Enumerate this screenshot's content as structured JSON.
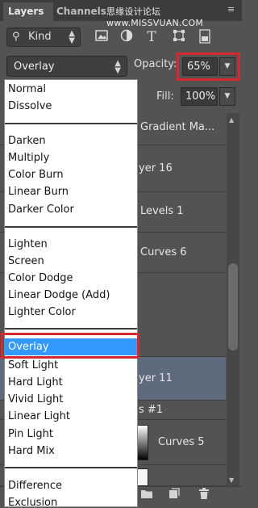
{
  "tabs": [
    {
      "label": "Layers",
      "active": true
    },
    {
      "label": "Channels",
      "active": false
    }
  ],
  "watermark": "思缘设计论坛 www.MISSVUAN.COM",
  "filter": {
    "kind_label": "Kind",
    "icons": [
      "image-filter-icon",
      "adjustment-filter-icon",
      "type-filter-icon",
      "shape-filter-icon",
      "smart-object-filter-icon"
    ]
  },
  "blend_mode": {
    "selected": "Overlay"
  },
  "opacity": {
    "label": "Opacity:",
    "value": "65%"
  },
  "fill": {
    "label": "Fill:",
    "value": "100%"
  },
  "layers": [
    {
      "name": "Gradient Ma..."
    },
    {
      "name": "yer 16"
    },
    {
      "name": "Levels 1"
    },
    {
      "name": "Curves 6"
    },
    {
      "name": "yer 11"
    },
    {
      "name": "s #1"
    },
    {
      "name": "Curves 5"
    }
  ],
  "blend_menu": {
    "groups": [
      [
        "Normal",
        "Dissolve"
      ],
      [
        "Darken",
        "Multiply",
        "Color Burn",
        "Linear Burn",
        "Darker Color"
      ],
      [
        "Lighten",
        "Screen",
        "Color Dodge",
        "Linear Dodge (Add)",
        "Lighter Color"
      ],
      [
        "Overlay",
        "Soft Light",
        "Hard Light",
        "Vivid Light",
        "Linear Light",
        "Pin Light",
        "Hard Mix"
      ],
      [
        "Difference",
        "Exclusion"
      ]
    ],
    "highlighted": "Overlay"
  },
  "colors": {
    "panel_bg": "#535353",
    "menu_highlight": "#3399ff",
    "annotation_red": "#d6282e",
    "selected_layer": "#5d6b7d"
  }
}
